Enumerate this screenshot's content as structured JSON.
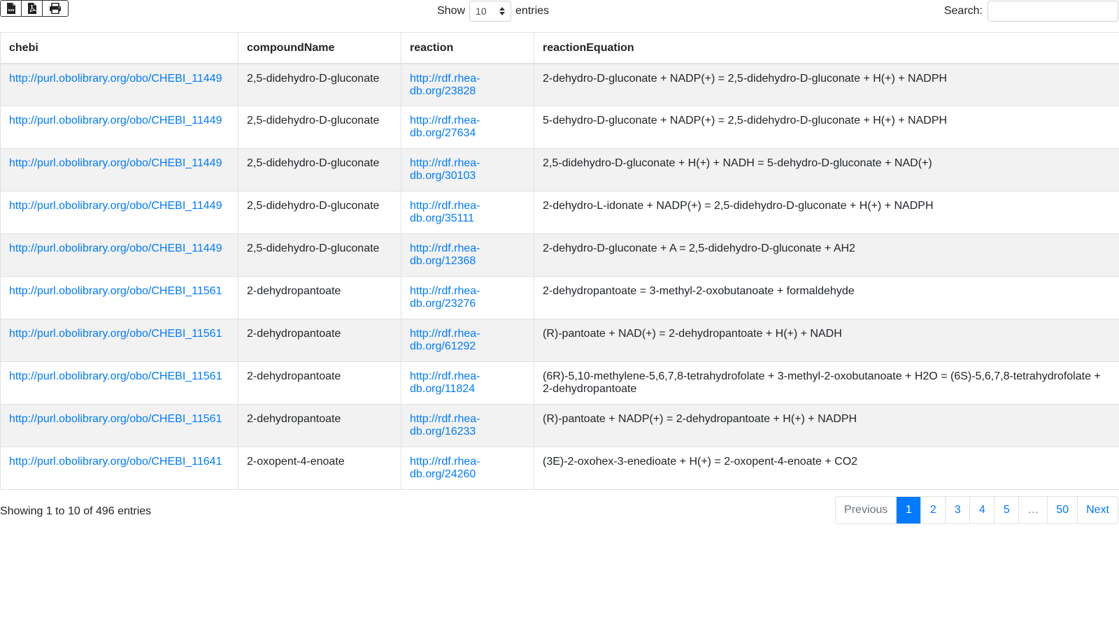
{
  "toolbar": {
    "buttons": [
      {
        "name": "csv-export-button",
        "icon": "csv-file-icon"
      },
      {
        "name": "pdf-export-button",
        "icon": "pdf-file-icon"
      },
      {
        "name": "print-button",
        "icon": "print-icon"
      }
    ]
  },
  "length_control": {
    "show_label": "Show",
    "selected_value": "10",
    "entries_label": "entries"
  },
  "search": {
    "label": "Search:",
    "value": "",
    "placeholder": ""
  },
  "table": {
    "columns": [
      "chebi",
      "compoundName",
      "reaction",
      "reactionEquation"
    ],
    "rows": [
      {
        "chebi": "http://purl.obolibrary.org/obo/CHEBI_11449",
        "compoundName": "2,5-didehydro-D-gluconate",
        "reaction": "http://rdf.rhea-db.org/23828",
        "reactionEquation": "2-dehydro-D-gluconate + NADP(+) = 2,5-didehydro-D-gluconate + H(+) + NADPH"
      },
      {
        "chebi": "http://purl.obolibrary.org/obo/CHEBI_11449",
        "compoundName": "2,5-didehydro-D-gluconate",
        "reaction": "http://rdf.rhea-db.org/27634",
        "reactionEquation": "5-dehydro-D-gluconate + NADP(+) = 2,5-didehydro-D-gluconate + H(+) + NADPH"
      },
      {
        "chebi": "http://purl.obolibrary.org/obo/CHEBI_11449",
        "compoundName": "2,5-didehydro-D-gluconate",
        "reaction": "http://rdf.rhea-db.org/30103",
        "reactionEquation": "2,5-didehydro-D-gluconate + H(+) + NADH = 5-dehydro-D-gluconate + NAD(+)"
      },
      {
        "chebi": "http://purl.obolibrary.org/obo/CHEBI_11449",
        "compoundName": "2,5-didehydro-D-gluconate",
        "reaction": "http://rdf.rhea-db.org/35111",
        "reactionEquation": "2-dehydro-L-idonate + NADP(+) = 2,5-didehydro-D-gluconate + H(+) + NADPH"
      },
      {
        "chebi": "http://purl.obolibrary.org/obo/CHEBI_11449",
        "compoundName": "2,5-didehydro-D-gluconate",
        "reaction": "http://rdf.rhea-db.org/12368",
        "reactionEquation": "2-dehydro-D-gluconate + A = 2,5-didehydro-D-gluconate + AH2"
      },
      {
        "chebi": "http://purl.obolibrary.org/obo/CHEBI_11561",
        "compoundName": "2-dehydropantoate",
        "reaction": "http://rdf.rhea-db.org/23276",
        "reactionEquation": "2-dehydropantoate = 3-methyl-2-oxobutanoate + formaldehyde"
      },
      {
        "chebi": "http://purl.obolibrary.org/obo/CHEBI_11561",
        "compoundName": "2-dehydropantoate",
        "reaction": "http://rdf.rhea-db.org/61292",
        "reactionEquation": "(R)-pantoate + NAD(+) = 2-dehydropantoate + H(+) + NADH"
      },
      {
        "chebi": "http://purl.obolibrary.org/obo/CHEBI_11561",
        "compoundName": "2-dehydropantoate",
        "reaction": "http://rdf.rhea-db.org/11824",
        "reactionEquation": "(6R)-5,10-methylene-5,6,7,8-tetrahydrofolate + 3-methyl-2-oxobutanoate + H2O = (6S)-5,6,7,8-tetrahydrofolate + 2-dehydropantoate"
      },
      {
        "chebi": "http://purl.obolibrary.org/obo/CHEBI_11561",
        "compoundName": "2-dehydropantoate",
        "reaction": "http://rdf.rhea-db.org/16233",
        "reactionEquation": "(R)-pantoate + NADP(+) = 2-dehydropantoate + H(+) + NADPH"
      },
      {
        "chebi": "http://purl.obolibrary.org/obo/CHEBI_11641",
        "compoundName": "2-oxopent-4-enoate",
        "reaction": "http://rdf.rhea-db.org/24260",
        "reactionEquation": "(3E)-2-oxohex-3-enedioate + H(+) = 2-oxopent-4-enoate + CO2"
      }
    ]
  },
  "footer": {
    "info": "Showing 1 to 10 of 496 entries"
  },
  "pagination": {
    "items": [
      {
        "label": "Previous",
        "state": "disabled"
      },
      {
        "label": "1",
        "state": "active"
      },
      {
        "label": "2",
        "state": "normal"
      },
      {
        "label": "3",
        "state": "normal"
      },
      {
        "label": "4",
        "state": "normal"
      },
      {
        "label": "5",
        "state": "normal"
      },
      {
        "label": "…",
        "state": "ellipsis"
      },
      {
        "label": "50",
        "state": "normal"
      },
      {
        "label": "Next",
        "state": "normal"
      }
    ]
  },
  "colors": {
    "link": "#007bff",
    "active_page_bg": "#007bff",
    "stripe_row_bg": "#f2f2f2"
  }
}
